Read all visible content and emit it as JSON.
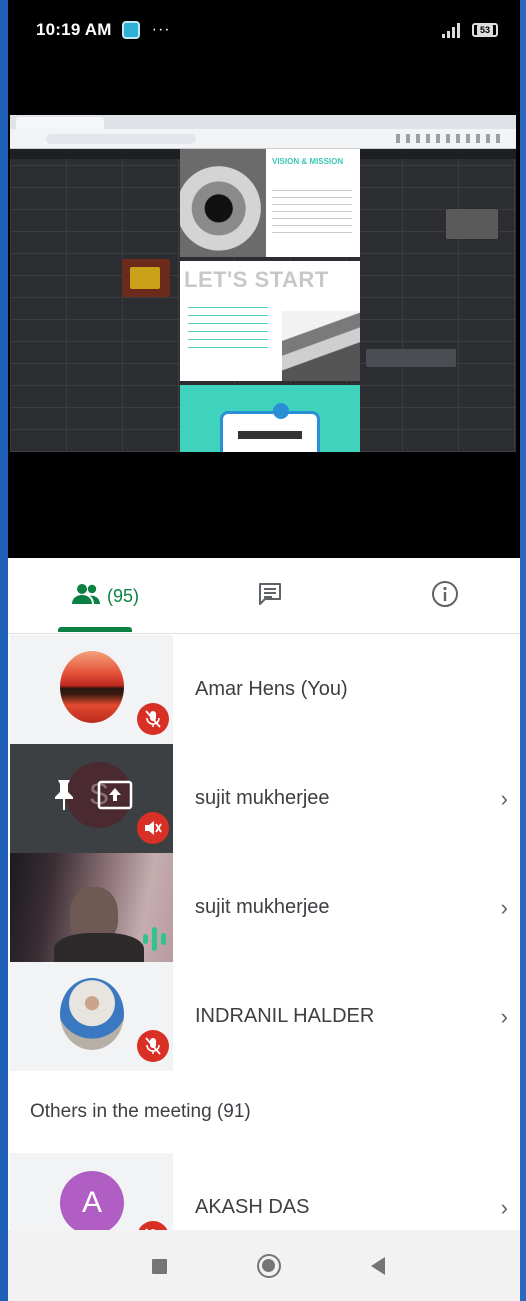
{
  "status_bar": {
    "time": "10:19 AM",
    "overflow": "···",
    "battery": "53"
  },
  "shared_screen": {
    "slide1_title": "VISION & MISSION",
    "slide2_title": "LET'S START"
  },
  "tabs": {
    "people_count": "(95)",
    "active_color": "#0b8043"
  },
  "participants": [
    {
      "name": "Amar Hens (You)",
      "muted": true
    },
    {
      "name": "sujit mukherjee",
      "muted": true,
      "presenting": true,
      "initial": "S"
    },
    {
      "name": "sujit mukherjee",
      "speaking": true
    },
    {
      "name": "INDRANIL HALDER",
      "muted": true
    }
  ],
  "others": {
    "header": "Others in the meeting (91)",
    "first": {
      "name": "AKASH DAS",
      "initial": "A",
      "avatar_color": "#b05ec4"
    }
  },
  "icons": {
    "people_tab": "people-icon",
    "chat_tab": "chat-icon",
    "info_tab": "info-icon",
    "mute": "mic-off-icon",
    "nav_recents": "square-icon",
    "nav_home": "circle-icon",
    "nav_back": "triangle-back-icon"
  },
  "chevron": "›"
}
